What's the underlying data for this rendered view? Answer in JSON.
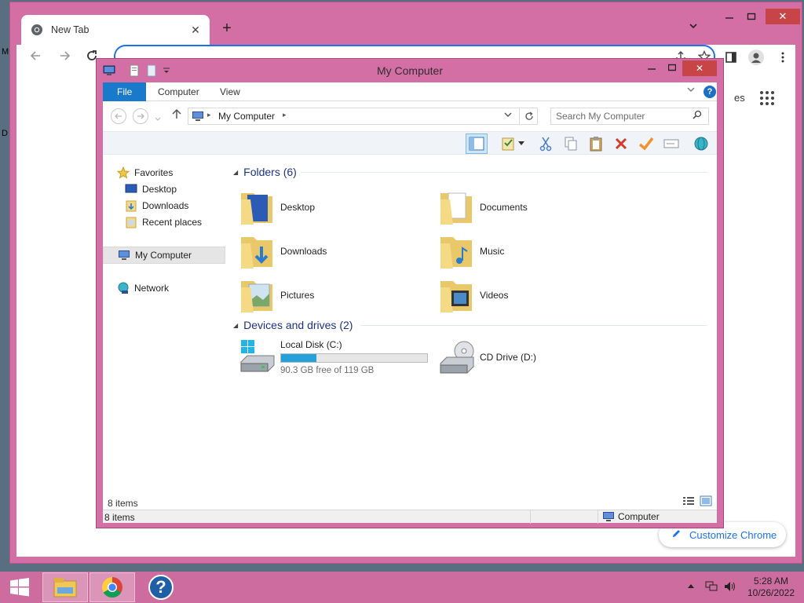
{
  "chrome": {
    "tab_title": "New Tab",
    "new_tab_glyph": "+",
    "omnibox_value": "",
    "partial_link_text": "es",
    "customize_label": "Customize Chrome",
    "icons": [
      "chrome-logo-icon",
      "close-icon",
      "back-arrow-icon",
      "forward-arrow-icon",
      "reload-icon",
      "share-icon",
      "star-icon",
      "sidebar-icon",
      "profile-icon",
      "kebab-menu-icon",
      "apps-grid-icon",
      "pencil-icon"
    ]
  },
  "explorer": {
    "title": "My Computer",
    "ribbon_tabs": [
      "File",
      "Computer",
      "View"
    ],
    "address_crumb": "My Computer",
    "search_placeholder": "Search My Computer",
    "nav": {
      "favorites": "Favorites",
      "desktop": "Desktop",
      "downloads": "Downloads",
      "recent": "Recent places",
      "my_computer": "My Computer",
      "network": "Network"
    },
    "folders_header": "Folders (6)",
    "folders": [
      "Desktop",
      "Documents",
      "Downloads",
      "Music",
      "Pictures",
      "Videos"
    ],
    "devices_header": "Devices and drives (2)",
    "drives": {
      "c_name": "Local Disk (C:)",
      "c_free": "90.3 GB free of 119 GB",
      "c_used_fraction": 0.24,
      "d_name": "CD Drive (D:)"
    },
    "items_count": "8 items",
    "status_left": "8 items",
    "status_right": "Computer"
  },
  "taskbar": {
    "time": "5:28 AM",
    "date": "10/26/2022",
    "help_glyph": "?"
  },
  "colors": {
    "window_frame": "#d36fa5",
    "accent_blue": "#1979ca",
    "drive_bar": "#26a0da",
    "group_header_text": "#1e3287"
  }
}
